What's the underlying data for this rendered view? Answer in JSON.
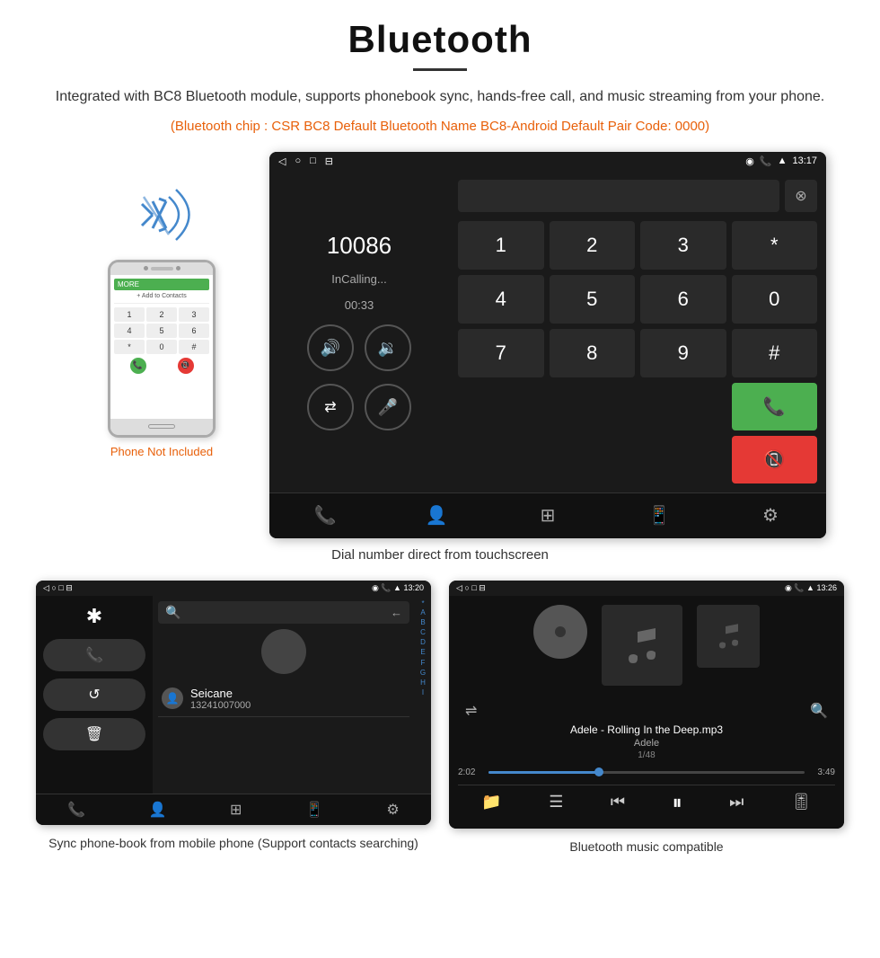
{
  "page": {
    "title": "Bluetooth",
    "divider": "—",
    "subtitle": "Integrated with BC8 Bluetooth module, supports phonebook sync, hands-free call, and music streaming from your phone.",
    "orange_info": "(Bluetooth chip : CSR BC8    Default Bluetooth Name BC8-Android    Default Pair Code: 0000)",
    "phone_not_included": "Phone Not Included",
    "dialer_caption": "Dial number direct from touchscreen",
    "contacts_caption": "Sync phone-book from mobile phone\n(Support contacts searching)",
    "music_caption": "Bluetooth music compatible"
  },
  "dialer_screen": {
    "status_bar": {
      "time": "13:17",
      "back_icon": "◁",
      "home_icon": "○",
      "square_icon": "□",
      "nav_icon": "⊟"
    },
    "number": "10086",
    "status": "InCalling...",
    "call_time": "00:33",
    "keys": [
      "1",
      "2",
      "3",
      "*",
      "4",
      "5",
      "6",
      "0",
      "7",
      "8",
      "9",
      "#"
    ],
    "volume_up": "🔊+",
    "volume_down": "🔉",
    "transfer": "⇄",
    "mute": "🎤"
  },
  "contacts_screen": {
    "status_bar": {
      "time": "13:20"
    },
    "contact_name": "Seicane",
    "contact_number": "13241007000",
    "alphabet": [
      "*",
      "A",
      "B",
      "C",
      "D",
      "E",
      "F",
      "G",
      "H",
      "I"
    ]
  },
  "music_screen": {
    "status_bar": {
      "time": "13:26"
    },
    "song_title": "Adele - Rolling In the Deep.mp3",
    "artist": "Adele",
    "track_info": "1/48",
    "time_current": "2:02",
    "time_total": "3:49"
  },
  "bottom_nav": {
    "icons": [
      "📞",
      "👤",
      "⊞",
      "📱",
      "⚙"
    ]
  }
}
